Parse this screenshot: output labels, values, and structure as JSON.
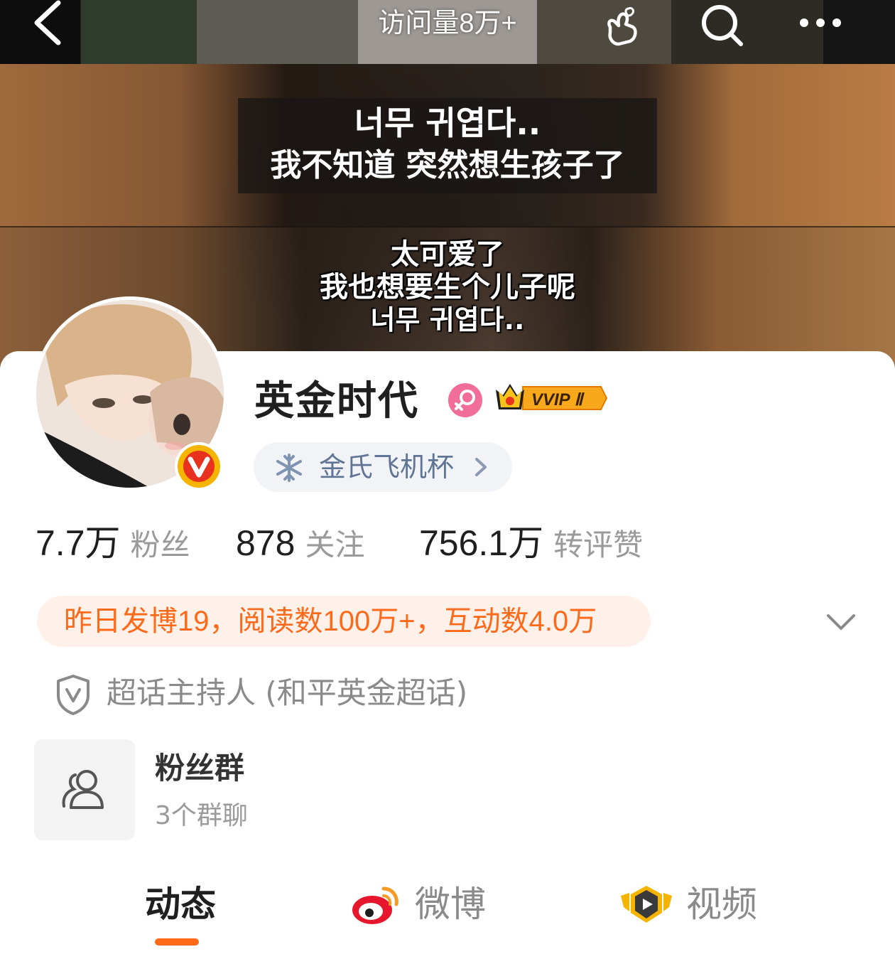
{
  "header": {
    "title": "访问量8万+"
  },
  "cover": {
    "caption_top_ko": "너무 귀엽다..",
    "caption_top_zh": "我不知道 突然想生孩子了",
    "caption_bottom_line1": "太可爱了",
    "caption_bottom_line2": "我也想要生个儿子呢",
    "caption_bottom_line3": "너무 귀엽다.."
  },
  "profile": {
    "name": "英金时代",
    "vip_label": "VVIP Ⅱ",
    "tag_label": "金氏飞机杯",
    "colors": {
      "accent": "#ff6a1a",
      "gender_badge": "#f26e9a",
      "verified_badge": "#f5b400",
      "chip_text": "#607595"
    }
  },
  "stats": [
    {
      "value": "7.7万",
      "label": "粉丝"
    },
    {
      "value": "878",
      "label": "关注"
    },
    {
      "value": "756.1万",
      "label": "转评赞"
    }
  ],
  "summary": {
    "text": "昨日发博19，阅读数100万+，互动数4.0万"
  },
  "host": {
    "text": "超话主持人 (和平英金超话)"
  },
  "fan_group": {
    "title": "粉丝群",
    "subtitle": "3个群聊"
  },
  "tabs": [
    {
      "label": "动态",
      "active": true
    },
    {
      "label": "微博",
      "icon": "weibo-icon"
    },
    {
      "label": "视频",
      "icon": "video-play-icon"
    }
  ]
}
